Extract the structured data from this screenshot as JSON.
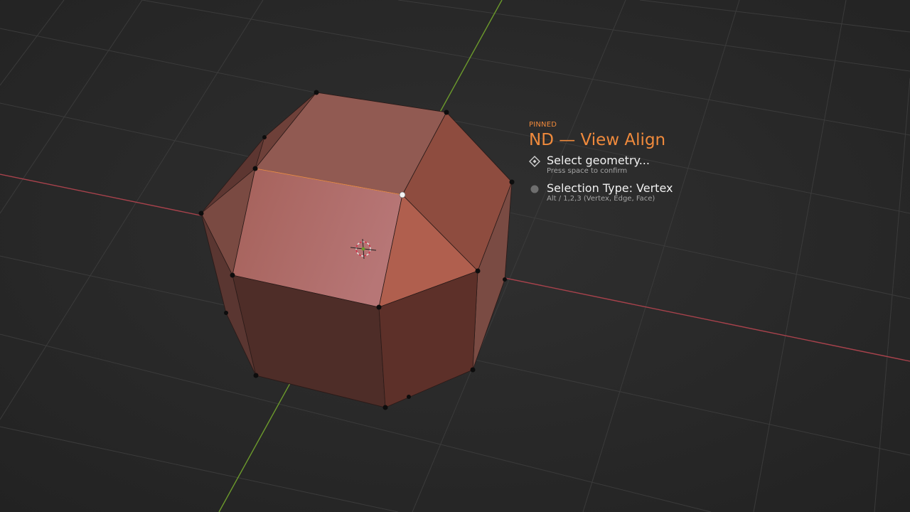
{
  "hud": {
    "pinned_label": "PINNED",
    "title": "ND — View Align",
    "steps": [
      {
        "label": "Select geometry...",
        "hint": "Press space to confirm",
        "icon": "diamond-select-icon"
      },
      {
        "label": "Selection Type: Vertex",
        "hint": "Alt / 1,2,3 (Vertex, Edge, Face)",
        "icon": "circle-dot-icon"
      }
    ]
  },
  "colors": {
    "viewport_background": "#2b2b2b",
    "grid_line": "#3a3a3a",
    "x_axis": "#a8424c",
    "y_axis": "#6c9a2c",
    "accent_orange": "#f08a3c",
    "mesh_face": "#a8584a",
    "vertex": "#0d0d0d",
    "active_vertex": "#ffffff"
  }
}
